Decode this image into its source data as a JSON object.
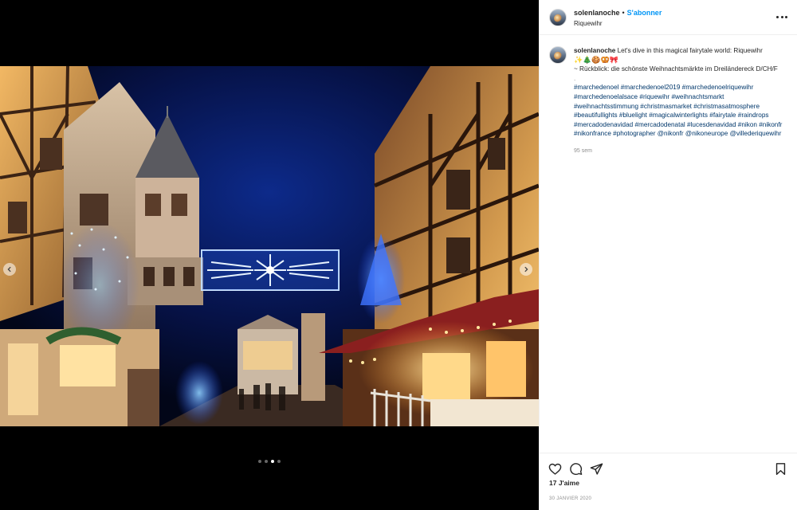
{
  "post": {
    "username": "solenlanoche",
    "separator": "•",
    "follow_label": "S'abonner",
    "location": "Riquewihr",
    "caption": {
      "author": "solenlanoche",
      "line1": "Let's dive in this magical fairytale world: Riquewihr",
      "emojis": "✨🎄🍪🥨🎀",
      "line2": "~ Rückblick: die schönste Weihnachtsmärkte im Dreiländereck D/CH/F",
      "spacer": ".",
      "hashtags": [
        "#marchedenoel",
        "#marchedenoel2019",
        "#marchedenoelriquewihr",
        "#marchedenoelalsace",
        "#riquewihr",
        "#weihnachtsmarkt",
        "#weihnachtsstimmung",
        "#christmasmarket",
        "#christmasatmosphere",
        "#beautifullights",
        "#bluelight",
        "#magicalwinterlights",
        "#fairytale",
        "#raindrops",
        "#mercadodenavidad",
        "#mercadodenatal",
        "#lucesdenavidad",
        "#nikon",
        "#nikonfr",
        "#nikonfrance",
        "#photographer",
        "@nikonfr",
        "@nikoneurope",
        "@villederiquewihr"
      ],
      "time_ago": "95 sem"
    },
    "likes": "17 J'aime",
    "date": "30 JANVIER 2020"
  },
  "carousel": {
    "current": 3,
    "total": 4
  },
  "icons": {
    "like": "heart-icon",
    "comment": "comment-icon",
    "share": "share-icon",
    "save": "bookmark-icon",
    "more": "more-options-icon",
    "prev": "chevron-left-icon",
    "next": "chevron-right-icon"
  },
  "colors": {
    "link_blue": "#0095f6",
    "hashtag": "#00376b",
    "muted": "#8e8e8e"
  }
}
